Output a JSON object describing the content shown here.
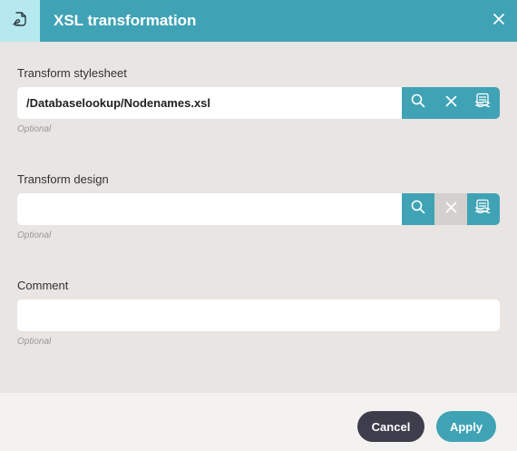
{
  "dialog": {
    "title": "XSL transformation",
    "header_icon": "xsl-document-icon",
    "close_icon": "close-icon"
  },
  "fields": [
    {
      "label": "Transform stylesheet",
      "value": "/Databaselookup/Nodenames.xsl",
      "hint": "Optional",
      "buttons": [
        "search-icon",
        "clear-icon",
        "stylesheet-icon"
      ]
    },
    {
      "label": "Transform design",
      "value": "",
      "hint": "Optional",
      "buttons": [
        "search-icon",
        "clear-icon",
        "stylesheet-icon"
      ]
    },
    {
      "label": "Comment",
      "value": "",
      "hint": "Optional"
    }
  ],
  "footer": {
    "cancel_label": "Cancel",
    "apply_label": "Apply"
  },
  "colors": {
    "accent": "#3fa3b5",
    "dark_button": "#3e3d4b",
    "background": "#e8e5e2",
    "disabled": "#d4d0cd"
  }
}
